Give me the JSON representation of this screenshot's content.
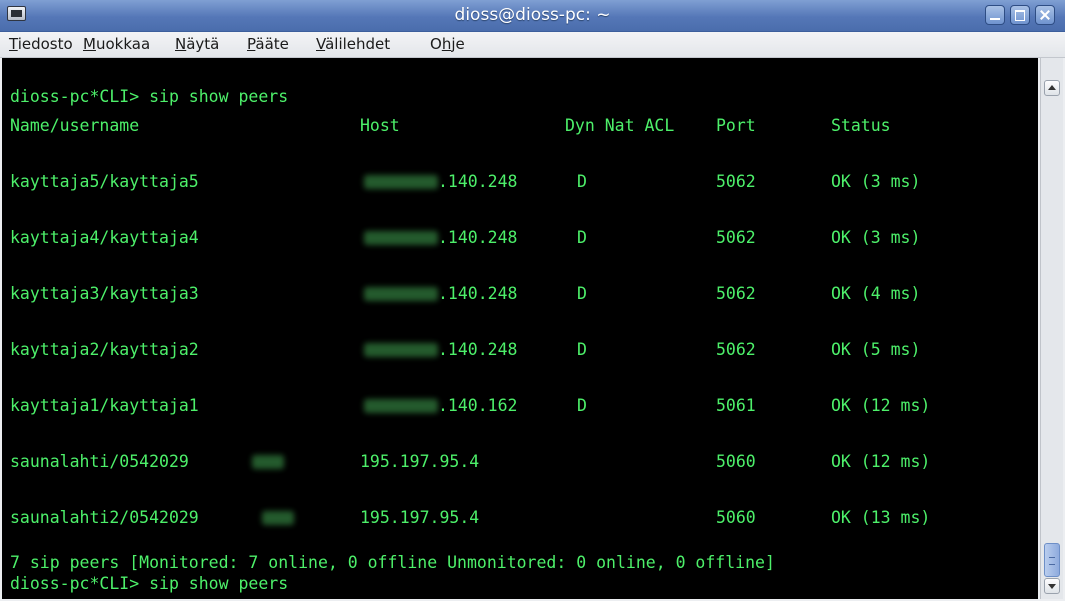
{
  "window": {
    "title": "dioss@dioss-pc: ~",
    "icon": "terminal-icon"
  },
  "menubar": {
    "items": [
      {
        "mnemonic": "T",
        "rest": "iedosto"
      },
      {
        "mnemonic": "M",
        "rest": "uokkaa"
      },
      {
        "mnemonic": "N",
        "rest": "äytä"
      },
      {
        "mnemonic": "P",
        "rest": "ääte"
      },
      {
        "mnemonic": "V",
        "rest": "älilehdet"
      },
      {
        "pre": "O",
        "mnemonic": "h",
        "rest": "je"
      }
    ]
  },
  "terminal": {
    "prompt_line": "dioss-pc*CLI> sip show peers",
    "headers": {
      "name": "Name/username",
      "host": "Host",
      "flags": "Dyn Nat ACL",
      "port": "Port",
      "status": "Status"
    },
    "rows": [
      {
        "name": "kayttaja5/kayttaja5",
        "host": ".140.248",
        "dyn": "D",
        "port": "5062",
        "status": "OK (3 ms)"
      },
      {
        "name": "kayttaja4/kayttaja4",
        "host": ".140.248",
        "dyn": "D",
        "port": "5062",
        "status": "OK (3 ms)"
      },
      {
        "name": "kayttaja3/kayttaja3",
        "host": ".140.248",
        "dyn": "D",
        "port": "5062",
        "status": "OK (4 ms)"
      },
      {
        "name": "kayttaja2/kayttaja2",
        "host": ".140.248",
        "dyn": "D",
        "port": "5062",
        "status": "OK (5 ms)"
      },
      {
        "name": "kayttaja1/kayttaja1",
        "host": ".140.162",
        "dyn": "D",
        "port": "5061",
        "status": "OK (12 ms)"
      },
      {
        "name": "saunalahti/0542029",
        "host": "195.197.95.4",
        "dyn": "",
        "port": "5060",
        "status": "OK (12 ms)"
      },
      {
        "name": "saunalahti2/0542029",
        "host": "195.197.95.4",
        "dyn": "",
        "port": "5060",
        "status": "OK (13 ms)"
      }
    ],
    "summary": "7 sip peers [Monitored: 7 online, 0 offline Unmonitored: 0 online, 0 offline]",
    "last_prompt": "dioss-pc*CLI> sip show peers"
  },
  "colors": {
    "terminal_bg": "#000000",
    "terminal_fg": "#4df06a",
    "titlebar": "#5577b7"
  }
}
